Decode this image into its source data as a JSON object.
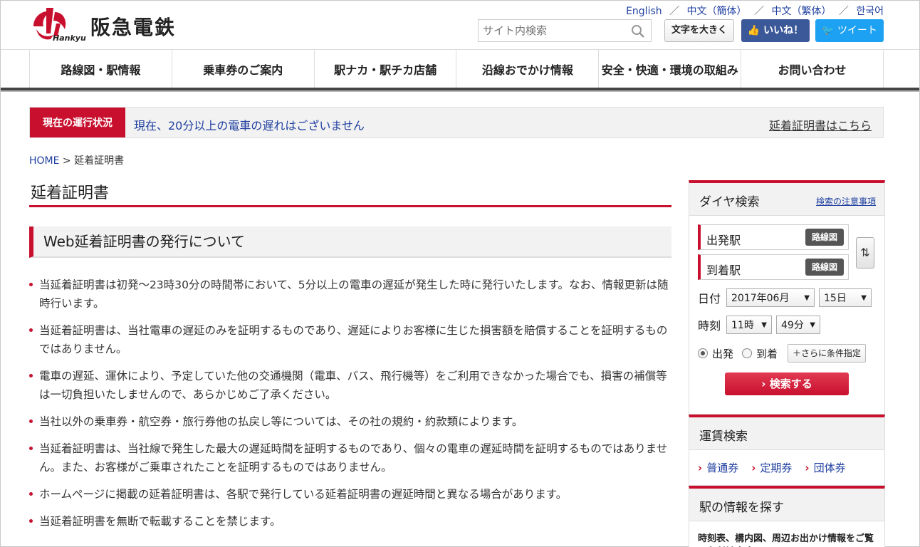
{
  "header": {
    "logo_name": "阪急電鉄",
    "logo_sub": "Hankyu",
    "languages": [
      "English",
      "中文（簡体）",
      "中文（繁体）",
      "한국어"
    ],
    "search_placeholder": "サイト内検索",
    "font_size_button": "文字を大きく",
    "like_button": "いいね！",
    "tweet_button": "ツイート",
    "colors": {
      "brand": "#c8102e",
      "facebook": "#3b5998",
      "twitter": "#1da1f2"
    }
  },
  "nav": {
    "items": [
      "路線図・駅情報",
      "乗車券のご案内",
      "駅ナカ・駅チカ店舗",
      "沿線おでかけ情報",
      "安全・快適・環境の取組み",
      "お問い合わせ"
    ]
  },
  "status": {
    "badge": "現在の運行状況",
    "message": "現在、20分以上の電車の遅れはございません",
    "link": "延着証明書はこちら"
  },
  "breadcrumb": {
    "home": "HOME",
    "sep": " > ",
    "current": "延着証明書"
  },
  "main": {
    "title": "延着証明書",
    "section_title": "Web延着証明書の発行について",
    "notes": [
      "当延着証明書は初発～23時30分の時間帯において、5分以上の電車の遅延が発生した時に発行いたします。なお、情報更新は随時行います。",
      "当延着証明書は、当社電車の遅延のみを証明するものであり、遅延によりお客様に生じた損害額を賠償することを証明するものではありません。",
      "電車の遅延、運休により、予定していた他の交通機関（電車、バス、飛行機等）をご利用できなかった場合でも、損害の補償等は一切負担いたしませんので、あらかじめご了承ください。",
      "当社以外の乗車券・航空券・旅行券他の払戻し等については、その社の規約・約款類によります。",
      "当延着証明書は、当社線で発生した最大の遅延時間を証明するものであり、個々の電車の遅延時間を証明するものではありません。また、お客様がご乗車されたことを証明するものではありません。",
      "ホームページに掲載の延着証明書は、各駅で発行している延着証明書の遅延時間と異なる場合があります。",
      "当延着証明書を無断で転載することを禁じます。"
    ]
  },
  "sidebar": {
    "dia": {
      "title": "ダイヤ検索",
      "notice_link": "検索の注意事項",
      "from_label": "出発駅",
      "to_label": "到着駅",
      "map_button": "路線図",
      "date_label": "日付",
      "month": "2017年06月",
      "day": "15日",
      "time_label": "時刻",
      "hour": "11時",
      "minute": "49分",
      "depart": "出発",
      "arrive": "到着",
      "more_conditions": "＋さらに条件指定",
      "search_button": "検索する"
    },
    "fare": {
      "title": "運賃検索",
      "links": [
        "普通券",
        "定期券",
        "団体券"
      ]
    },
    "station": {
      "title": "駅の情報を探す",
      "text": "時刻表、構内図、周辺お出かけ情報をご覧いただけます。"
    }
  }
}
